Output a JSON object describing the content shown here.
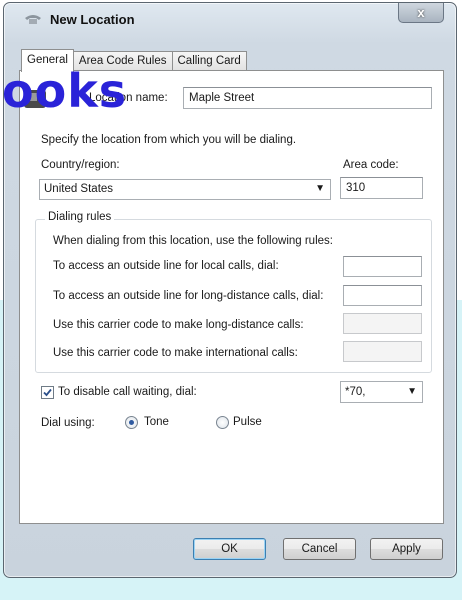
{
  "window": {
    "title": "New Location",
    "close_label": "x"
  },
  "tabs": [
    {
      "label": "General",
      "active": true
    },
    {
      "label": "Area Code Rules",
      "active": false
    },
    {
      "label": "Calling Card",
      "active": false
    }
  ],
  "watermark_text": "ooks",
  "location": {
    "label": "Location name:",
    "value": "Maple Street"
  },
  "instruction": "Specify the location from which you will be dialing.",
  "country": {
    "label": "Country/region:",
    "value": "United States"
  },
  "area_code": {
    "label": "Area code:",
    "value": "310"
  },
  "dialing_rules": {
    "title": "Dialing rules",
    "intro": "When dialing from this location, use the following rules:",
    "local_label": "To access an outside line for local calls, dial:",
    "local_value": "",
    "long_distance_label": "To access an outside line for long-distance calls, dial:",
    "long_distance_value": "",
    "carrier_ld_label": "Use this carrier code to make long-distance calls:",
    "carrier_ld_value": "",
    "carrier_intl_label": "Use this carrier code to make international calls:",
    "carrier_intl_value": ""
  },
  "call_waiting": {
    "label": "To disable call waiting, dial:",
    "checked": true,
    "value": "*70,"
  },
  "dial_using": {
    "label": "Dial using:",
    "tone_label": "Tone",
    "pulse_label": "Pulse",
    "selected": "Tone"
  },
  "buttons": {
    "ok": "OK",
    "cancel": "Cancel",
    "apply": "Apply"
  },
  "colors": {
    "watermark": "#2a23d8",
    "stripe_teal": "#d6f3f7",
    "stripe_pink": "#f6c9d4"
  }
}
